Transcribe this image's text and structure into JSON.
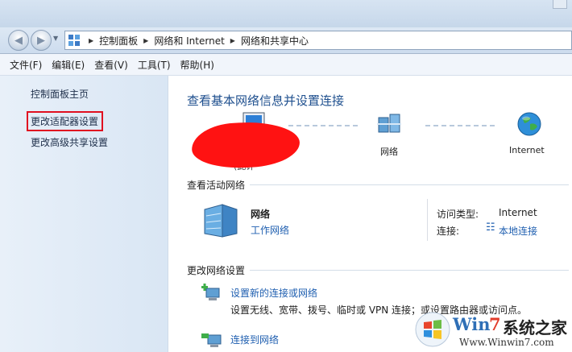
{
  "address": {
    "crumbs": [
      "控制面板",
      "网络和 Internet",
      "网络和共享中心"
    ]
  },
  "menu": [
    "文件(F)",
    "编辑(E)",
    "查看(V)",
    "工具(T)",
    "帮助(H)"
  ],
  "sidebar": {
    "items": [
      "控制面板主页",
      "更改适配器设置",
      "更改高级共享设置"
    ]
  },
  "main": {
    "title": "查看基本网络信息并设置连接",
    "map": {
      "pc_partial_label": "(此计",
      "network_label": "网络",
      "internet_label": "Internet"
    },
    "active_section": "查看活动网络",
    "network": {
      "name": "网络",
      "type_link": "工作网络",
      "access_label": "访问类型:",
      "access_value": "Internet",
      "connection_label": "连接:",
      "connection_value": "本地连接"
    },
    "change_section": "更改网络设置",
    "tasks": [
      {
        "link": "设置新的连接或网络",
        "desc": "设置无线、宽带、拨号、临时或 VPN 连接；或设置路由器或访问点。"
      },
      {
        "link": "连接到网络",
        "desc": ""
      }
    ]
  },
  "watermark": {
    "brand_win": "Win",
    "brand_7": "7",
    "brand_cn": "系统之家",
    "url": "Www.Winwin7.com"
  },
  "colors": {
    "highlight": "#e01020",
    "link": "#1f5fb0",
    "title": "#1e4f8e"
  }
}
